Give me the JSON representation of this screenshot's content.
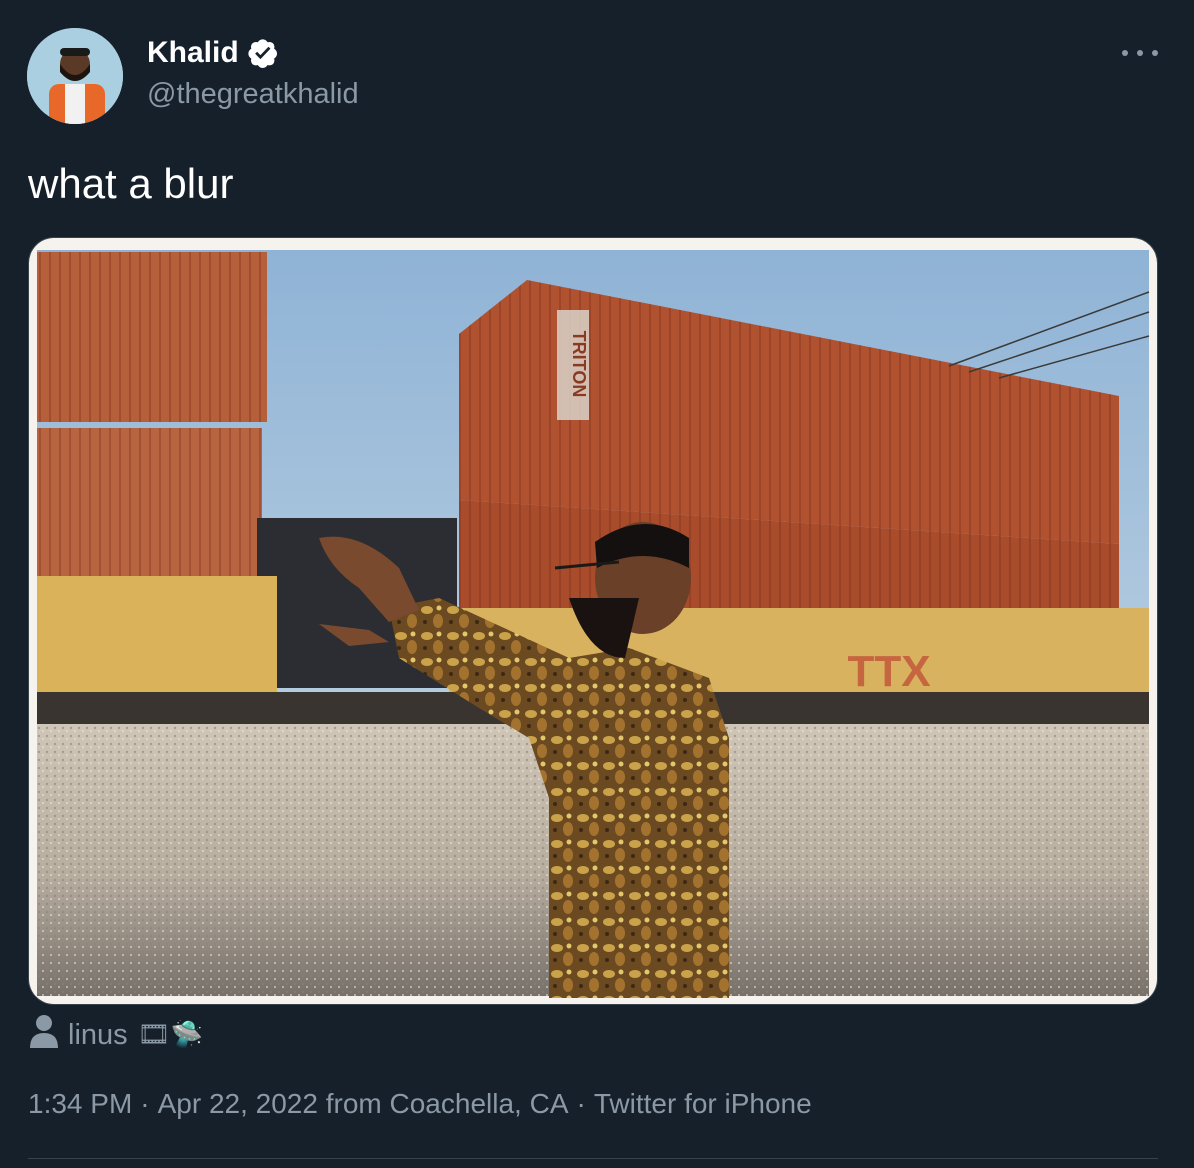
{
  "author": {
    "name": "Khalid",
    "handle": "@thegreatkhalid",
    "verified_icon": "verified-badge-icon",
    "avatar_icon": "avatar"
  },
  "more_icon": "more-options-icon",
  "tweet": {
    "text": "what a blur"
  },
  "media": {
    "container_text": "TRITON",
    "railcar_text": "TTX"
  },
  "tagged": {
    "icon": "person-icon",
    "name": "linus",
    "emoji": "🎞🛸"
  },
  "meta": {
    "time": "1:34 PM",
    "separator": "·",
    "date_location": "Apr 22, 2022 from Coachella, CA",
    "source": "Twitter for iPhone"
  },
  "colors": {
    "background": "#15202b",
    "secondary_text": "#8b98a5",
    "verified": "#ffffff",
    "divider": "#38444d"
  }
}
